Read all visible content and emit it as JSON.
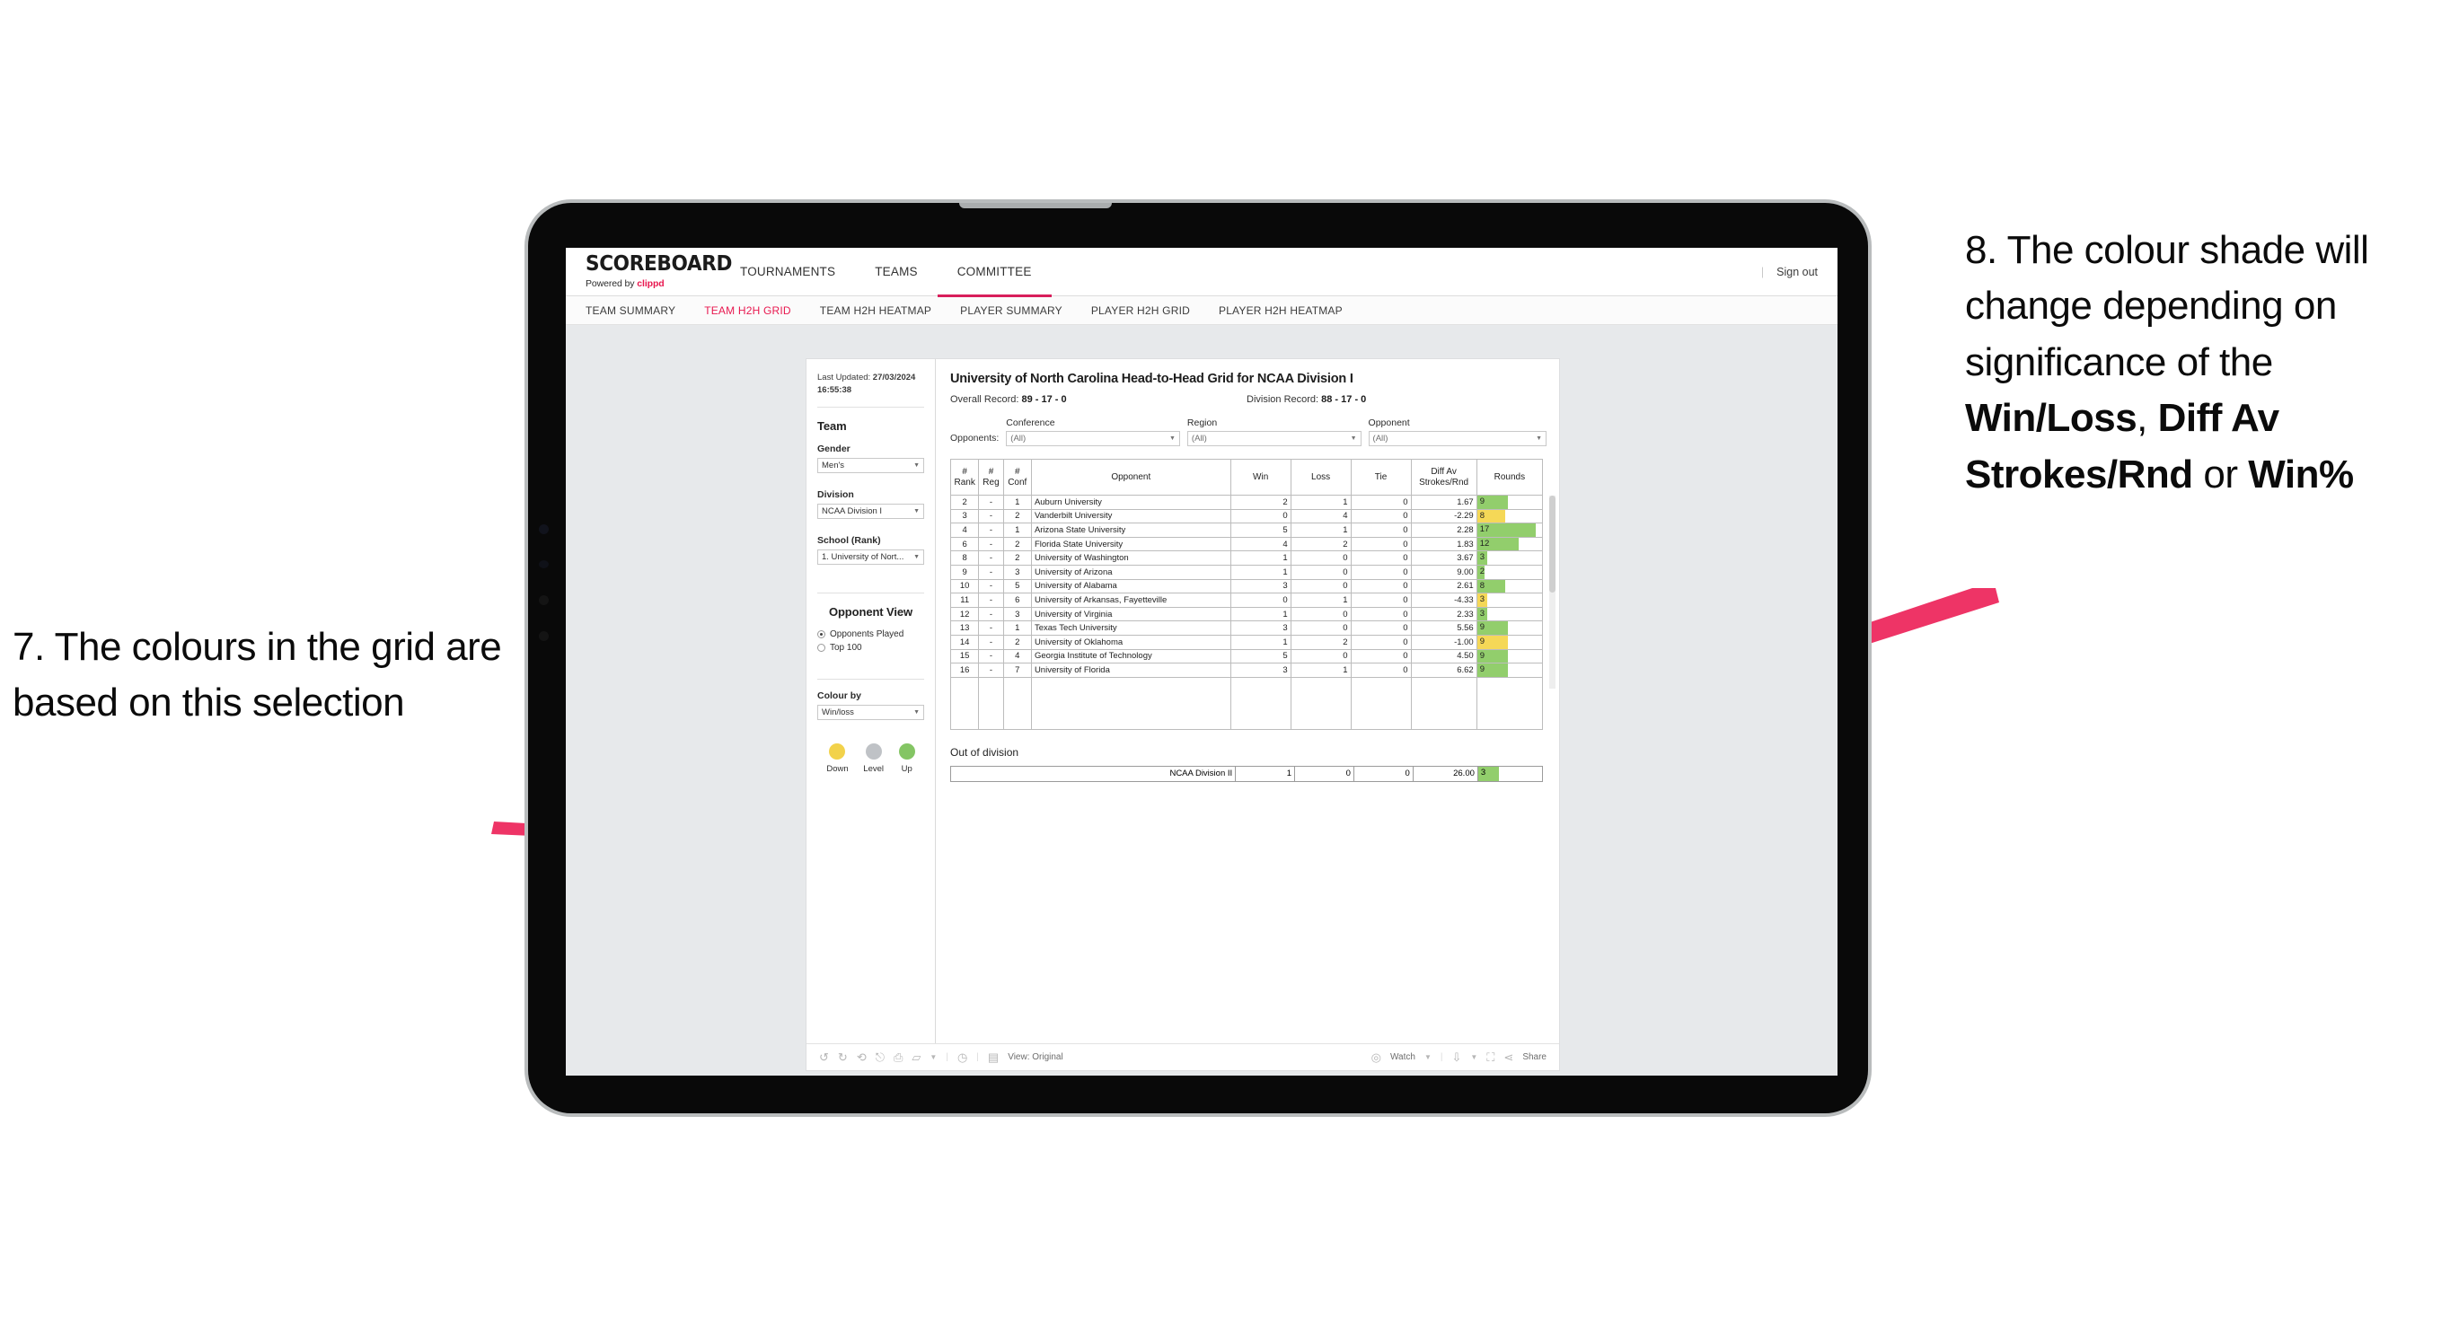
{
  "annotations": {
    "left": "7. The colours in the grid are based on this selection",
    "right_pre": "8. The colour shade will change depending on significance of the ",
    "right_b1": "Win/Loss",
    "right_mid1": ", ",
    "right_b2": "Diff Av Strokes/Rnd",
    "right_mid2": " or ",
    "right_b3": "Win%",
    "arrow_color": "#ee3466"
  },
  "app": {
    "brand": {
      "wordmark": "SCOREBOARD",
      "powered_prefix": "Powered by ",
      "powered_brand": "clippd"
    },
    "main_nav": [
      {
        "label": "TOURNAMENTS",
        "active": false
      },
      {
        "label": "TEAMS",
        "active": false
      },
      {
        "label": "COMMITTEE",
        "active": true
      }
    ],
    "sign_out": "Sign out",
    "sub_nav": [
      {
        "label": "TEAM SUMMARY",
        "active": false
      },
      {
        "label": "TEAM H2H GRID",
        "active": true
      },
      {
        "label": "TEAM H2H HEATMAP",
        "active": false
      },
      {
        "label": "PLAYER SUMMARY",
        "active": false
      },
      {
        "label": "PLAYER H2H GRID",
        "active": false
      },
      {
        "label": "PLAYER H2H HEATMAP",
        "active": false
      }
    ]
  },
  "sidebar": {
    "last_updated_label": "Last Updated: ",
    "last_updated_value": "27/03/2024 16:55:38",
    "team_heading": "Team",
    "gender_label": "Gender",
    "gender_value": "Men's",
    "division_label": "Division",
    "division_value": "NCAA Division I",
    "school_label": "School (Rank)",
    "school_value": "1. University of Nort...",
    "opponent_view_heading": "Opponent View",
    "opponent_view_options": [
      {
        "label": "Opponents Played",
        "selected": true
      },
      {
        "label": "Top 100",
        "selected": false
      }
    ],
    "colour_by_label": "Colour by",
    "colour_by_value": "Win/loss",
    "legend": [
      {
        "caption": "Down",
        "color": "#f2d24b"
      },
      {
        "caption": "Level",
        "color": "#bfc2c6"
      },
      {
        "caption": "Up",
        "color": "#84c564"
      }
    ]
  },
  "main": {
    "title": "University of North Carolina Head-to-Head Grid for NCAA Division I",
    "overall_record_label": "Overall Record: ",
    "overall_record_value": "89 - 17 - 0",
    "division_record_label": "Division Record: ",
    "division_record_value": "88 - 17 - 0",
    "opponents_label": "Opponents:",
    "filters": [
      {
        "label": "Conference",
        "value": "(All)"
      },
      {
        "label": "Region",
        "value": "(All)"
      },
      {
        "label": "Opponent",
        "value": "(All)"
      }
    ],
    "out_of_division_label": "Out of division",
    "out_of_division_row": {
      "name": "NCAA Division II",
      "win": "1",
      "loss": "0",
      "tie": "0",
      "diff": "26.00",
      "rounds": "3",
      "color": "g",
      "rounds_pct": 33
    }
  },
  "chart_data": {
    "type": "table",
    "title": "University of North Carolina Head-to-Head Grid for NCAA Division I",
    "columns": [
      "# Rank",
      "# Reg",
      "# Conf",
      "Opponent",
      "Win",
      "Loss",
      "Tie",
      "Diff Av Strokes/Rnd",
      "Rounds"
    ],
    "rows": [
      {
        "rank": "2",
        "reg": "-",
        "conf": "1",
        "opponent": "Auburn University",
        "win": "2",
        "loss": "1",
        "tie": "0",
        "diff": "1.67",
        "rounds": "9",
        "color": "g",
        "rounds_pct": 48
      },
      {
        "rank": "3",
        "reg": "-",
        "conf": "2",
        "opponent": "Vanderbilt University",
        "win": "0",
        "loss": "4",
        "tie": "0",
        "diff": "-2.29",
        "rounds": "8",
        "color": "y",
        "rounds_pct": 43
      },
      {
        "rank": "4",
        "reg": "-",
        "conf": "1",
        "opponent": "Arizona State University",
        "win": "5",
        "loss": "1",
        "tie": "0",
        "diff": "2.28",
        "rounds": "17",
        "color": "g",
        "rounds_pct": 90
      },
      {
        "rank": "6",
        "reg": "-",
        "conf": "2",
        "opponent": "Florida State University",
        "win": "4",
        "loss": "2",
        "tie": "0",
        "diff": "1.83",
        "rounds": "12",
        "color": "g",
        "rounds_pct": 64
      },
      {
        "rank": "8",
        "reg": "-",
        "conf": "2",
        "opponent": "University of Washington",
        "win": "1",
        "loss": "0",
        "tie": "0",
        "diff": "3.67",
        "rounds": "3",
        "color": "g",
        "rounds_pct": 16
      },
      {
        "rank": "9",
        "reg": "-",
        "conf": "3",
        "opponent": "University of Arizona",
        "win": "1",
        "loss": "0",
        "tie": "0",
        "diff": "9.00",
        "rounds": "2",
        "color": "g",
        "rounds_pct": 11
      },
      {
        "rank": "10",
        "reg": "-",
        "conf": "5",
        "opponent": "University of Alabama",
        "win": "3",
        "loss": "0",
        "tie": "0",
        "diff": "2.61",
        "rounds": "8",
        "color": "g",
        "rounds_pct": 43
      },
      {
        "rank": "11",
        "reg": "-",
        "conf": "6",
        "opponent": "University of Arkansas, Fayetteville",
        "win": "0",
        "loss": "1",
        "tie": "0",
        "diff": "-4.33",
        "rounds": "3",
        "color": "y",
        "rounds_pct": 16
      },
      {
        "rank": "12",
        "reg": "-",
        "conf": "3",
        "opponent": "University of Virginia",
        "win": "1",
        "loss": "0",
        "tie": "0",
        "diff": "2.33",
        "rounds": "3",
        "color": "g",
        "rounds_pct": 16
      },
      {
        "rank": "13",
        "reg": "-",
        "conf": "1",
        "opponent": "Texas Tech University",
        "win": "3",
        "loss": "0",
        "tie": "0",
        "diff": "5.56",
        "rounds": "9",
        "color": "g",
        "rounds_pct": 48
      },
      {
        "rank": "14",
        "reg": "-",
        "conf": "2",
        "opponent": "University of Oklahoma",
        "win": "1",
        "loss": "2",
        "tie": "0",
        "diff": "-1.00",
        "rounds": "9",
        "color": "y",
        "rounds_pct": 48
      },
      {
        "rank": "15",
        "reg": "-",
        "conf": "4",
        "opponent": "Georgia Institute of Technology",
        "win": "5",
        "loss": "0",
        "tie": "0",
        "diff": "4.50",
        "rounds": "9",
        "color": "g",
        "rounds_pct": 48
      },
      {
        "rank": "16",
        "reg": "-",
        "conf": "7",
        "opponent": "University of Florida",
        "win": "3",
        "loss": "1",
        "tie": "0",
        "diff": "6.62",
        "rounds": "9",
        "color": "g",
        "rounds_pct": 48
      }
    ],
    "colors": {
      "up": "#92ce6c",
      "down": "#f5d857",
      "level": "#bfc2c6"
    }
  },
  "toolbar": {
    "view_label": "View: Original",
    "watch_label": "Watch",
    "share_label": "Share"
  }
}
